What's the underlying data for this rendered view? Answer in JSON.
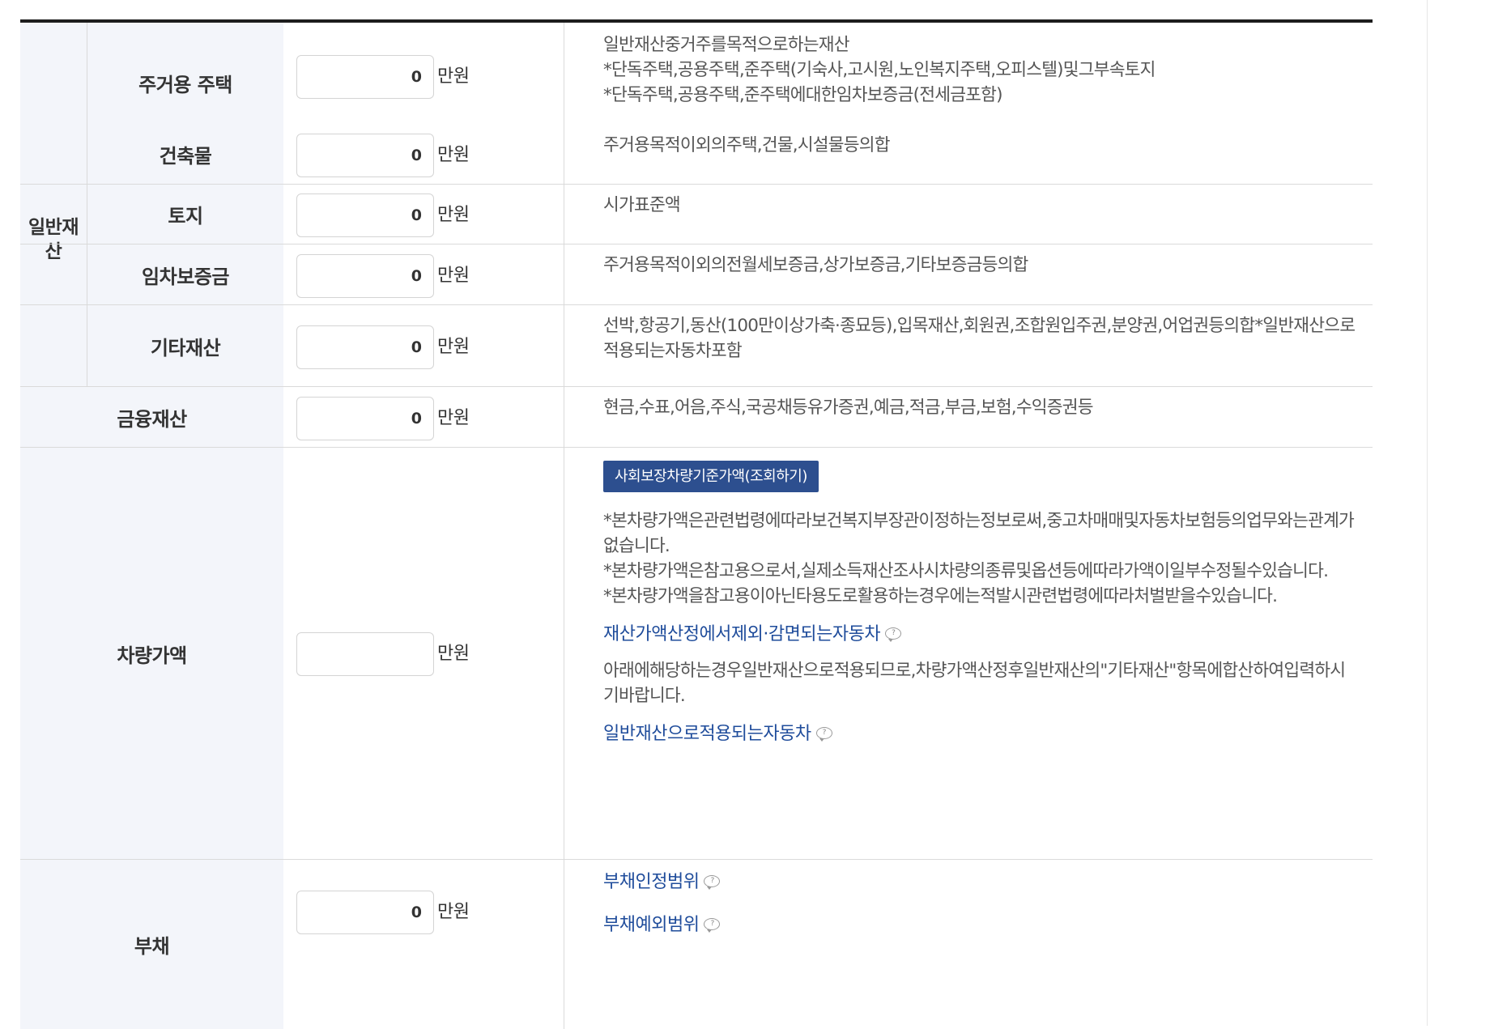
{
  "unit": "만원",
  "general_assets": {
    "group_label": "일반재산",
    "rows": [
      {
        "label": "주거용 주택",
        "value": "0",
        "desc": [
          "일반재산중거주를목적으로하는재산",
          "*단독주택,공용주택,준주택(기숙사,고시원,노인복지주택,오피스텔)및그부속토지",
          "*단독주택,공용주택,준주택에대한임차보증금(전세금포함)"
        ]
      },
      {
        "label": "건축물",
        "value": "0",
        "desc": [
          "주거용목적이외의주택,건물,시설물등의합"
        ]
      },
      {
        "label": "토지",
        "value": "0",
        "desc": [
          "시가표준액"
        ]
      },
      {
        "label": "임차보증금",
        "value": "0",
        "desc": [
          "주거용목적이외의전월세보증금,상가보증금,기타보증금등의합"
        ]
      },
      {
        "label": "기타재산",
        "value": "0",
        "desc": [
          "선박,항공기,동산(100만이상가축·종묘등),입목재산,회원권,조합원입주권,분양권,어업권등의합*일반재산으로적용되는자동차포함"
        ]
      }
    ]
  },
  "financial": {
    "label": "금융재산",
    "value": "0",
    "desc": "현금,수표,어음,주식,국공채등유가증권,예금,적금,부금,보험,수익증권등"
  },
  "vehicle": {
    "label": "차량가액",
    "value": "",
    "lookup_button": "사회보장차량기준가액(조회하기)",
    "notes": [
      "*본차량가액은관련법령에따라보건복지부장관이정하는정보로써,중고차매매및자동차보험등의업무와는관계가없습니다.",
      "*본차량가액은참고용으로서,실제소득재산조사시차량의종류및옵션등에따라가액이일부수정될수있습니다.",
      "*본차량가액을참고용이아닌타용도로활용하는경우에는적발시관련법령에따라처벌받을수있습니다."
    ],
    "link_exempt": "재산가액산정에서제외·감면되는자동차",
    "general_note": "아래에해당하는경우일반재산으로적용되므로,차량가액산정후일반재산의\"기타재산\"항목에합산하여입력하시기바랍니다.",
    "link_general": "일반재산으로적용되는자동차"
  },
  "debt": {
    "label": "부채",
    "value": "0",
    "link_scope": "부채인정범위",
    "link_exclude": "부채예외범위"
  }
}
